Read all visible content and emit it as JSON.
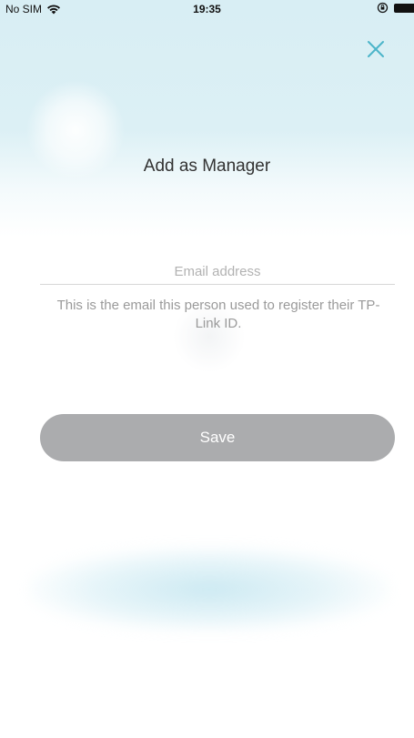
{
  "status_bar": {
    "carrier": "No SIM",
    "time": "19:35"
  },
  "header": {
    "title": "Add as Manager",
    "close_icon": "close-icon"
  },
  "form": {
    "email_placeholder": "Email address",
    "email_value": "",
    "helper_text": "This is the email this person used to register their TP-Link ID.",
    "save_label": "Save"
  },
  "colors": {
    "accent": "#4cb5c9",
    "save_button_disabled": "#abacae",
    "title_text": "#333333",
    "helper_text": "#9a9a9a"
  }
}
